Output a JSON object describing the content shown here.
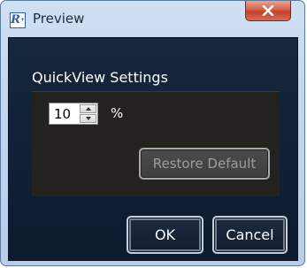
{
  "window": {
    "title": "Preview",
    "app_icon": "app-logo-icon",
    "close_icon": "close-icon"
  },
  "quickview": {
    "group_title": "QuickView Settings",
    "value": "10",
    "unit": "%",
    "restore_default_label": "Restore Default"
  },
  "footer": {
    "ok_label": "OK",
    "cancel_label": "Cancel"
  },
  "colors": {
    "close_button": "#c9503a",
    "dialog_background": "#142338",
    "group_background": "#24221f",
    "disabled_text": "#9d9d9d"
  }
}
